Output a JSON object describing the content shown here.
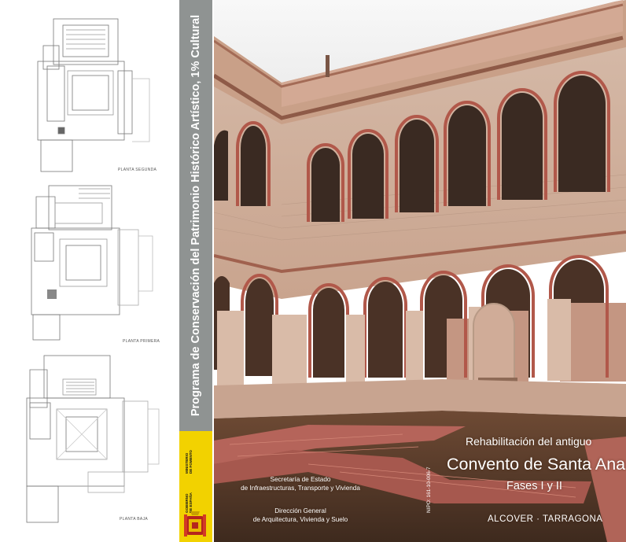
{
  "plans": {
    "labels": [
      "PLANTA SEGUNDA",
      "PLANTA PRIMERA",
      "PLANTA BAJA"
    ]
  },
  "spine": {
    "title": "Programa de Conservación del Patrimonio Histórico Artístico, 1% Cultural",
    "ministry_1": "MINISTERIO\nDE FOMENTO",
    "ministry_2": "GOBIERNO\nDE ESPAÑA",
    "band_color": "#8f9392",
    "accent_color": "#f2d200"
  },
  "cover": {
    "subtitle_1": "Rehabilitación del antiguo",
    "title": "Convento de Santa Ana",
    "subtitle_2": "Fases I y II",
    "location": "ALCOVER · TARRAGONA",
    "secretary_1": "Secretaría de Estado",
    "secretary_2": "de Infraestructuras, Transporte y Vivienda",
    "direction_1": "Dirección General",
    "direction_2": "de Arquitectura, Vivienda y Suelo",
    "nipo": "NIPO: 161-10-006-7"
  }
}
